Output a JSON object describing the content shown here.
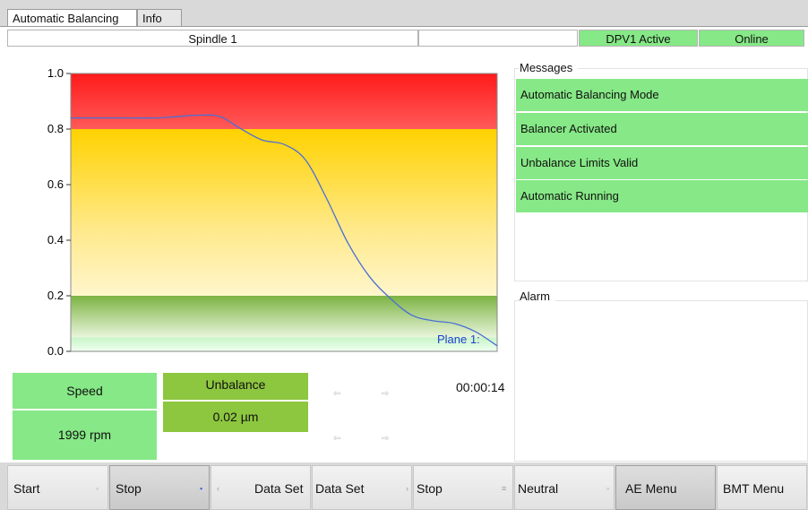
{
  "tabs": {
    "active": "Automatic Balancing",
    "inactive": "Info"
  },
  "status_bar": {
    "spindle": "Spindle 1",
    "empty": "",
    "dpv": "DPV1 Active",
    "online": "Online"
  },
  "colors": {
    "green_status": "#86e886",
    "unbalance_green": "#8dc63f",
    "zone_red": "#ff2a2a",
    "zone_yellow": "#ffd400",
    "zone_green": "#7cb342",
    "curve": "#4a6fd6",
    "plane_label": "#1f3fd1"
  },
  "chart_data": {
    "type": "line",
    "title": "",
    "xlabel": "",
    "ylabel": "",
    "ylim": [
      0,
      1.0
    ],
    "yticks": [
      "1.0",
      "0.8",
      "0.6",
      "0.4",
      "0.2",
      "0.0"
    ],
    "zones": [
      {
        "from": 0.8,
        "to": 1.0,
        "color": "red"
      },
      {
        "from": 0.2,
        "to": 0.8,
        "color": "yellow"
      },
      {
        "from": 0.05,
        "to": 0.2,
        "color": "green"
      },
      {
        "from": 0.0,
        "to": 0.05,
        "color": "light-green"
      }
    ],
    "series": [
      {
        "name": "Plane 1:",
        "x": [
          0,
          0.1,
          0.2,
          0.25,
          0.3,
          0.35,
          0.4,
          0.45,
          0.5,
          0.55,
          0.6,
          0.65,
          0.7,
          0.75,
          0.8,
          0.85,
          0.9,
          0.95,
          1.0
        ],
        "values": [
          0.84,
          0.84,
          0.84,
          0.845,
          0.85,
          0.845,
          0.8,
          0.76,
          0.745,
          0.69,
          0.55,
          0.39,
          0.27,
          0.19,
          0.13,
          0.11,
          0.1,
          0.07,
          0.02
        ]
      }
    ]
  },
  "messages": {
    "title": "Messages",
    "items": [
      "Automatic Balancing Mode",
      "Balancer Activated",
      "Unbalance Limits Valid",
      "Automatic Running"
    ]
  },
  "alarm": {
    "title": "Alarm"
  },
  "speed": {
    "label": "Speed",
    "value": "1999 rpm"
  },
  "unbalance": {
    "label": "Unbalance",
    "value": "0.02 µm"
  },
  "timer": "00:00:14",
  "softkeys": [
    {
      "label": "Start",
      "indicator": "◦",
      "pressed": false
    },
    {
      "label": "Stop",
      "indicator": "▪",
      "pressed": true
    },
    {
      "label": "Data Set",
      "indicator": "‹",
      "pressed": false
    },
    {
      "label": "Data Set",
      "indicator": "›",
      "pressed": false
    },
    {
      "label": "Stop",
      "indicator": "≡",
      "pressed": false
    },
    {
      "label": "Neutral",
      "indicator": "◦",
      "pressed": false
    },
    {
      "label": "AE Menu",
      "indicator": "",
      "pressed": true
    },
    {
      "label": "BMT Menu",
      "indicator": "",
      "pressed": false
    }
  ]
}
